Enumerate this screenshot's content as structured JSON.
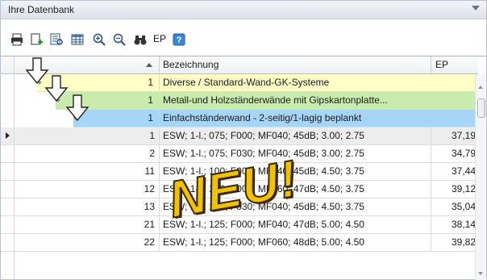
{
  "window": {
    "title": "Ihre Datenbank"
  },
  "toolbar": {
    "buttons": [
      {
        "icon": "printer-icon"
      },
      {
        "icon": "new-item-icon"
      },
      {
        "icon": "preview-icon"
      },
      {
        "icon": "table-columns-icon"
      },
      {
        "icon": "zoom-in-icon"
      },
      {
        "icon": "zoom-out-icon"
      },
      {
        "icon": "binoculars-icon"
      },
      {
        "icon": "ep-text-button",
        "label": "EP"
      },
      {
        "icon": "help-icon"
      }
    ]
  },
  "grid": {
    "headers": {
      "col1": "",
      "col2": "Bezeichnung",
      "col3": "EP"
    },
    "groups": [
      {
        "num": "1",
        "label": "Diverse / Standard-Wand-GK-Systeme",
        "color": "#ffffc8"
      },
      {
        "num": "1",
        "label": "Metall-und Holzständerwände  mit Gipskartonplatte...",
        "color": "#c9ecae"
      },
      {
        "num": "1",
        "label": "Einfachständerwand     - 2-seitig/1-lagig beplankt",
        "color": "#a7d5f7"
      }
    ],
    "rows": [
      {
        "num": "1",
        "desc": "ESW; 1-l.; 075; F000; MF040; 45dB; 3.00; 2.75",
        "ep": "37,19"
      },
      {
        "num": "2",
        "desc": "ESW; 1-l.; 075; F030; MF040; 45dB; 3.00; 2.75",
        "ep": "34,79"
      },
      {
        "num": "11",
        "desc": "ESW; 1-l.; 100; F000; MF040; 45dB; 4.50; 3.75",
        "ep": "37,44"
      },
      {
        "num": "12",
        "desc": "ESW; 1-l.; 100; F000; MF060; 47dB; 4.50; 3.75",
        "ep": "39,12"
      },
      {
        "num": "13",
        "desc": "ESW; 1-l.; 100; F030; MF040; 45dB; 4.50; 3.75",
        "ep": "35,04"
      },
      {
        "num": "21",
        "desc": "ESW; 1-l.; 125; F000; MF040; 47dB; 5.00; 4.50",
        "ep": "38,14"
      },
      {
        "num": "22",
        "desc": "ESW; 1-l.; 125; F000; MF060; 48dB; 5.00; 4.50",
        "ep": "39,82"
      }
    ]
  },
  "overlay": {
    "stamp_text": "NEU!"
  },
  "colors": {
    "group1": "#ffffc8",
    "group2": "#c9ecae",
    "group3": "#a7d5f7",
    "stamp": "#f2c200"
  }
}
